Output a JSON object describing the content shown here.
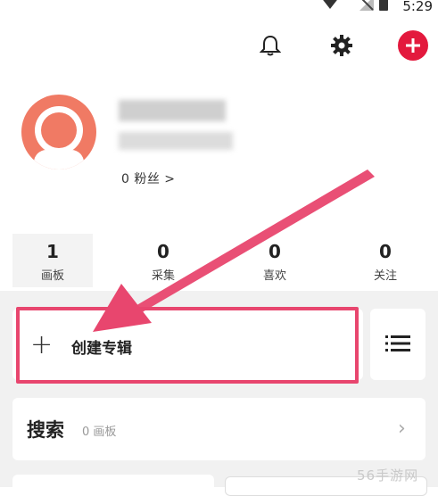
{
  "status_bar": {
    "time": "5:29"
  },
  "profile": {
    "followers": "0 粉丝 >"
  },
  "stats": [
    {
      "value": "1",
      "label": "画板"
    },
    {
      "value": "0",
      "label": "采集"
    },
    {
      "value": "0",
      "label": "喜欢"
    },
    {
      "value": "0",
      "label": "关注"
    }
  ],
  "create": {
    "plus": "+",
    "label": "创建专辑"
  },
  "search": {
    "title": "搜索",
    "count": "0 画板",
    "chevron": "›"
  },
  "watermark": "56手游网",
  "colors": {
    "accent": "#e3193d",
    "highlight": "#e8466e",
    "avatar": "#f07a64"
  },
  "icons": [
    "bell-icon",
    "gear-icon",
    "add-icon",
    "list-icon",
    "chevron-right-icon",
    "wifi-icon",
    "battery-icon"
  ]
}
